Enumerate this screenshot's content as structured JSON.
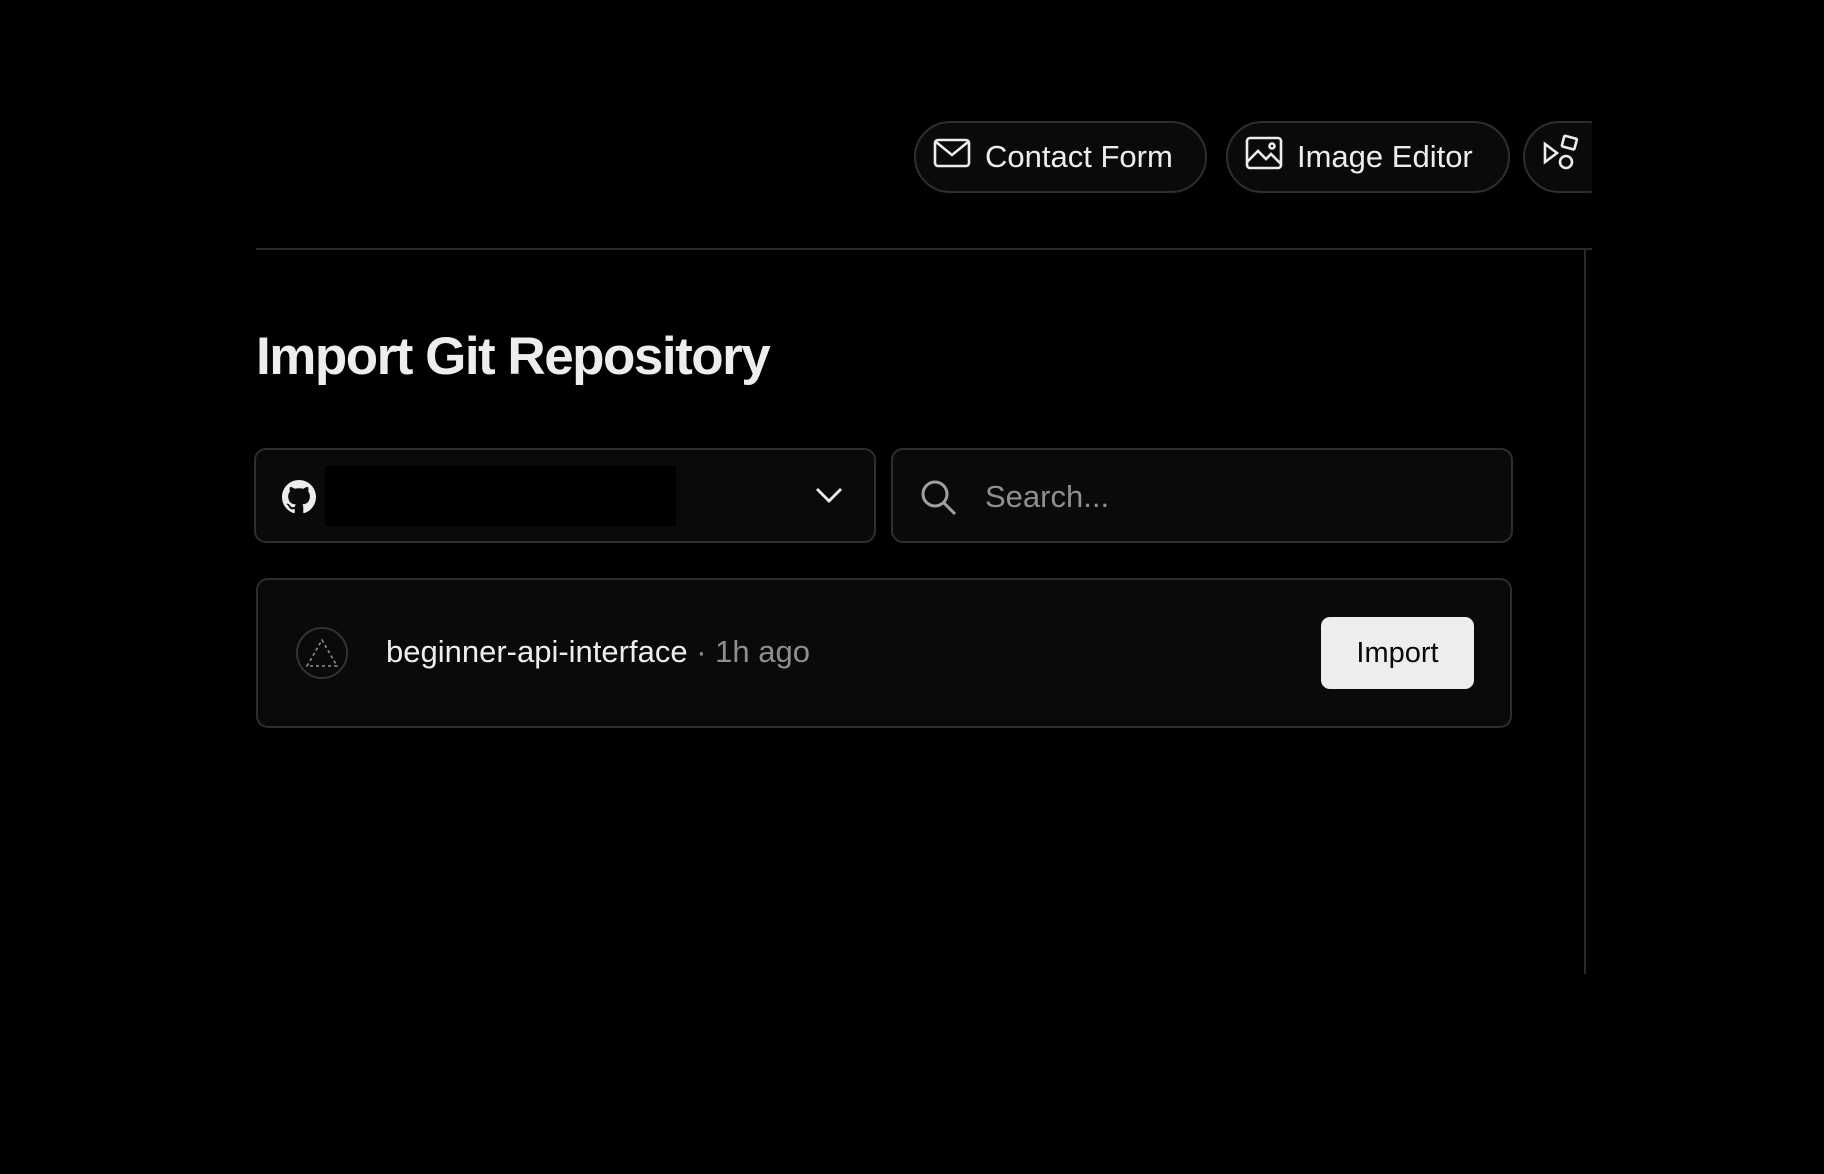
{
  "templates": {
    "items": [
      {
        "label": "Contact Form",
        "icon": "mail-icon"
      },
      {
        "label": "Image Editor",
        "icon": "image-icon"
      },
      {
        "label": "",
        "icon": "shapes-icon"
      }
    ]
  },
  "page": {
    "title": "Import Git Repository"
  },
  "account_selector": {
    "provider_icon": "github-icon",
    "selected_account": "",
    "chevron_icon": "chevron-down-icon"
  },
  "search": {
    "placeholder": "Search...",
    "value": ""
  },
  "repositories": [
    {
      "name": "beginner-api-interface",
      "separator": "·",
      "updated": "1h ago",
      "avatar_icon": "triangle-logo-icon",
      "action_label": "Import"
    }
  ],
  "colors": {
    "background": "#000000",
    "surface": "#0a0a0a",
    "border": "#2e2e2e",
    "text": "#ededed",
    "muted_text": "#8f8f8f",
    "button_bg": "#ededed"
  }
}
